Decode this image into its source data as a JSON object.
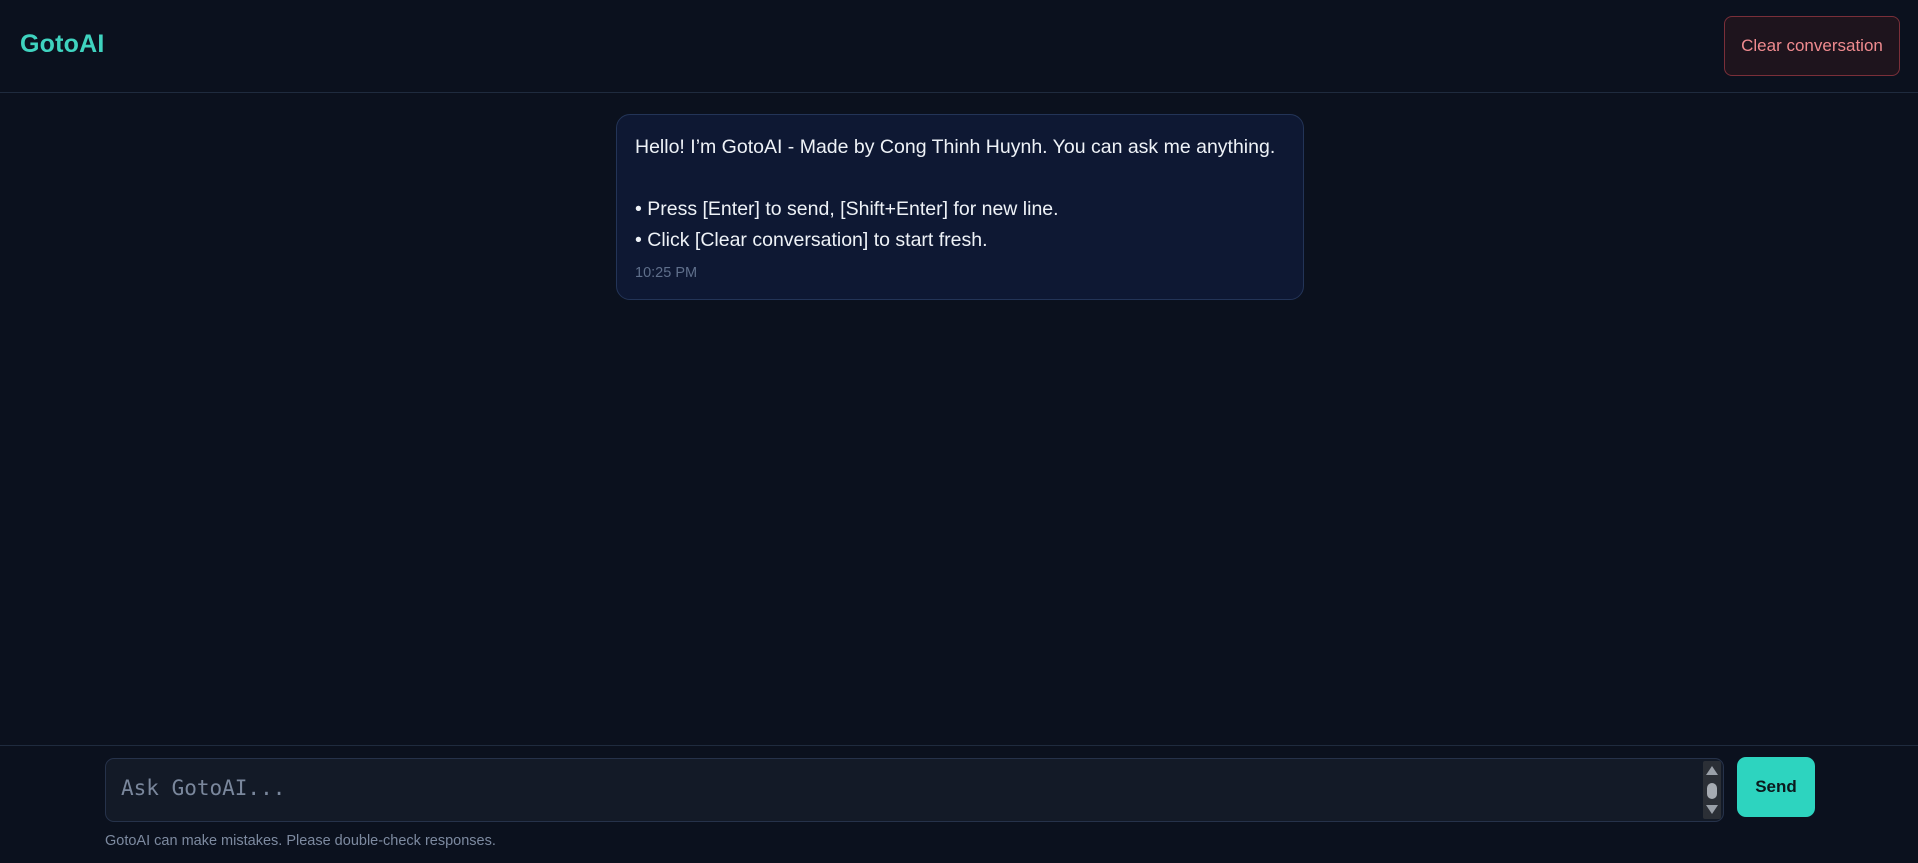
{
  "header": {
    "brand": "GotoAI",
    "clear_label": "Clear conversation"
  },
  "messages": [
    {
      "lines": [
        "Hello! I’m GotoAI - Made by Cong Thinh Huynh. You can ask me anything.",
        "",
        "• Press [Enter] to send, [Shift+Enter] for new line.",
        "• Click [Clear conversation] to start fresh."
      ],
      "time": "10:25 PM"
    }
  ],
  "composer": {
    "placeholder": "Ask GotoAI...",
    "value": "",
    "send_label": "Send",
    "disclaimer": "GotoAI can make mistakes. Please double-check responses."
  },
  "colors": {
    "background": "#0b111e",
    "accent": "#2dd4bf",
    "danger": "#f08b8f",
    "bubble": "#0e1833"
  }
}
